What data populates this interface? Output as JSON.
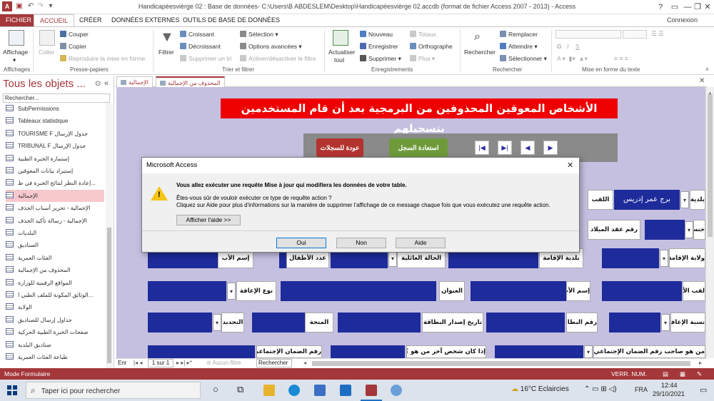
{
  "window": {
    "title": "Handicapéesvièrge 02 : Base de données- C:\\Users\\B ABDESLEM\\Desktop\\Handicapéesvièrge 02.accdb (format de fichier Access 2007 - 2013) - Access",
    "help": "?",
    "connexion": "Connexion"
  },
  "menu": {
    "tabs": [
      "FICHIER",
      "ACCUEIL",
      "CRÉER",
      "DONNÉES EXTERNES",
      "OUTILS DE BASE DE DONNÉES"
    ]
  },
  "ribbon": {
    "affichages": {
      "affichage": "Affichage",
      "group": "Affichages"
    },
    "clipboard": {
      "coller": "Coller",
      "couper": "Couper",
      "copier": "Copier",
      "reproduire": "Reproduire la mise en forme",
      "group": "Presse-papiers"
    },
    "filter": {
      "filtrer": "Filtrer",
      "croissant": "Croissant",
      "decroissant": "Décroissant",
      "supprimer_tri": "Supprimer un tri",
      "selection": "Sélection",
      "options": "Options avancées",
      "activer": "Activer/désactiver le filtre",
      "group": "Trier et filtrer"
    },
    "records": {
      "actualiser": "Actualiser",
      "tout": "tout",
      "nouveau": "Nouveau",
      "enregistrer": "Enregistrer",
      "supprimer": "Supprimer",
      "totaux": "Totaux",
      "orthographe": "Orthographe",
      "plus": "Plus",
      "group": "Enregistrements"
    },
    "find": {
      "rechercher": "Rechercher",
      "remplacer": "Remplacer",
      "atteindre": "Atteindre",
      "selectionner": "Sélectionner",
      "group": "Rechercher"
    },
    "text": {
      "group": "Mise en forme du texte"
    }
  },
  "nav": {
    "title": "Tous les objets ...",
    "search_placeholder": "Rechercher...",
    "items": [
      "SubPermissions",
      "Tableaux statistique",
      "TOURISME F جدول الإرسال",
      "TRIBUNAL F جدول الإرسال",
      "إستمارة الخبرة الطبية",
      "إستيراد بيانات المعوقين",
      "إعادة النظر لنتائج الخبرة في ط...",
      "الإجمالية",
      "الإجمالية - تحرير أسباب الحذف",
      "الإجمالية - رسالة تأكيد الحذف",
      "البلديات",
      "الصناديق",
      "الفئات العمرية",
      "المحذوف من الإجمالية",
      "المواقع الرقمية للوزارة",
      "الوثائق المكونة للملف الطبي ا...",
      "الولاية",
      "جداول إرسال للصناديق",
      "صفحات الخبرة الطبية الحركية",
      "صناديق البلدية",
      "طباعة الفئات العمرية"
    ]
  },
  "doc_tabs": [
    "الإجمالية",
    "المحذوف من الإجمالية"
  ],
  "form": {
    "title": "الأشخاص المعوقين المحذوفين من  البرمجية بعد أن قام المستخدمين بتسجيلهم",
    "btn_back": "عودة للسجلات",
    "btn_restore": "استعادة السجل",
    "labels": {
      "laqab": "اللقب",
      "commune": "بلدية",
      "raqm_aqd": "رقم عقد الميلاد",
      "jins": "جنس",
      "ism_ab": "إسم الأب",
      "adad_atfal": "عدد الأطفال",
      "hala": "الحالة العائلية",
      "baladiya_iqama": "بلدية الإقامة",
      "wilaya_iqama": "ولاية الإقامة",
      "naw_iaqa": "نوع الإعاقة",
      "unwan": "العنوان",
      "ism_umm": "إسم الأم",
      "laqab_umm": "لقب الأم",
      "tajdid": "التجديد",
      "minha": "المنحة",
      "tarikh": "تاريخ إصدار البطاقة",
      "raqm_bitaqa": "رقم البطاقة",
      "nisba": "نسبة الإعاقة",
      "raqm_daman": "رقم الضمان الإجتماعي",
      "shakhs_akhar": "إذا كان شخص آخر من هو ؟",
      "sahib": "من هو صاحب رقم الضمان الإجتماعي ؟"
    },
    "commune_value": "برج عمر إدريس"
  },
  "recnav": {
    "enr": "Enr",
    "position": "1 sur 1",
    "filter": "Aucun filtre",
    "search": "Rechercher"
  },
  "status": {
    "mode": "Mode Formulaire",
    "verr": "VERR. NUM."
  },
  "taskbar": {
    "search": "Taper ici pour rechercher",
    "weather": "16°C Eclaircies",
    "lang": "FRA",
    "time": "12:44",
    "date": "29/10/2021"
  },
  "dialog": {
    "title": "Microsoft Access",
    "main": "Vous allez exécuter une requête Mise à jour qui modifiera les données de votre table.",
    "line2": "Êtes-vous sûr de vouloir exécuter ce type de requête action ?",
    "line3": "Cliquez sur Aide pour plus d'informations sur la manière de supprimer l'affichage de ce message chaque fois que vous exécutez une requête action.",
    "show_help": "Afficher l'aide >>",
    "oui": "Oui",
    "non": "Non",
    "aide": "Aide"
  },
  "colors": {
    "access_red": "#a4373a",
    "form_bg": "#c5c0e0",
    "field_blue": "#1e2b9a",
    "title_red": "#ee0000",
    "restore_green": "#6e9a3a",
    "back_red": "#b2332f"
  }
}
